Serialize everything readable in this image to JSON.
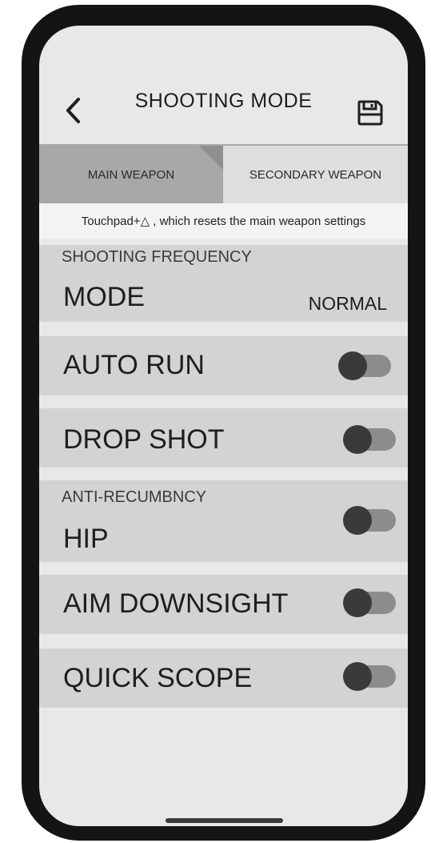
{
  "header": {
    "title": "SHOOTING MODE",
    "back_icon": "chevron-left-icon",
    "save_icon": "floppy-disk-icon"
  },
  "tabs": [
    {
      "label": "MAIN WEAPON",
      "selected": true
    },
    {
      "label": "SECONDARY WEAPON",
      "selected": false
    }
  ],
  "hint": "Touchpad+△ , which resets the main weapon settings",
  "shooting_frequency": {
    "section_label": "SHOOTING FREQUENCY",
    "label": "MODE",
    "value": "NORMAL"
  },
  "auto_run": {
    "label": "AUTO RUN",
    "on": false
  },
  "drop_shot": {
    "label": "DROP SHOT",
    "on": false
  },
  "anti_recumbency": {
    "section_label": "ANTI-RECUMBNCY",
    "label": "HIP",
    "on": false
  },
  "aim_downsight": {
    "label": "AIM DOWNSIGHT",
    "on": false
  },
  "quick_scope": {
    "label": "QUICK SCOPE",
    "on": false
  },
  "colors": {
    "background": "#e8e8e8",
    "row": "#d3d3d3",
    "tab_selected": "#a8a8a8",
    "toggle_knob": "#3a3a3a",
    "toggle_track": "#8c8c8c",
    "frame": "#141414"
  }
}
